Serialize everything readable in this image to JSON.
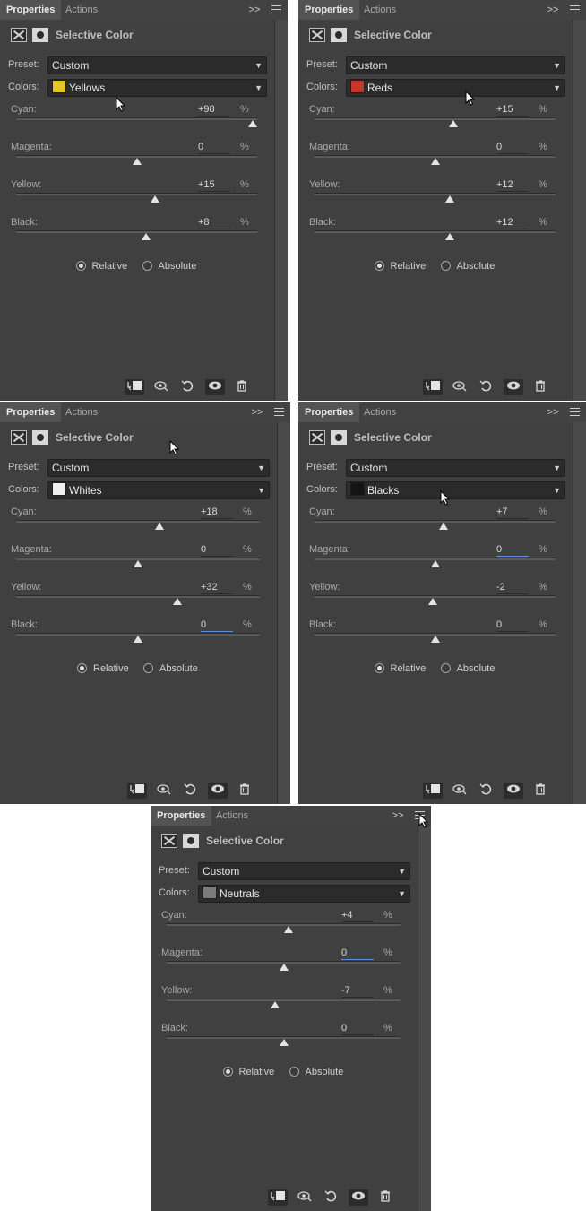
{
  "tabs": {
    "properties": "Properties",
    "actions": "Actions"
  },
  "collapse_glyph": ">>",
  "header_title": "Selective Color",
  "labels": {
    "preset": "Preset:",
    "colors": "Colors:"
  },
  "preset_value": "Custom",
  "radio": {
    "relative": "Relative",
    "absolute": "Absolute"
  },
  "percent": "%",
  "panels": [
    {
      "color_name": "Yellows",
      "swatch": "#e6c627",
      "sliders": [
        {
          "label": "Cyan:",
          "value": "+98",
          "pos": 0.98
        },
        {
          "label": "Magenta:",
          "value": "0",
          "pos": 0.5
        },
        {
          "label": "Yellow:",
          "value": "+15",
          "pos": 0.575
        },
        {
          "label": "Black:",
          "value": "+8",
          "pos": 0.54
        }
      ]
    },
    {
      "color_name": "Reds",
      "swatch": "#c0392b",
      "sliders": [
        {
          "label": "Cyan:",
          "value": "+15",
          "pos": 0.575
        },
        {
          "label": "Magenta:",
          "value": "0",
          "pos": 0.5
        },
        {
          "label": "Yellow:",
          "value": "+12",
          "pos": 0.56
        },
        {
          "label": "Black:",
          "value": "+12",
          "pos": 0.56
        }
      ]
    },
    {
      "color_name": "Whites",
      "swatch": "#efefef",
      "sliders": [
        {
          "label": "Cyan:",
          "value": "+18",
          "pos": 0.59
        },
        {
          "label": "Magenta:",
          "value": "0",
          "pos": 0.5
        },
        {
          "label": "Yellow:",
          "value": "+32",
          "pos": 0.66
        },
        {
          "label": "Black:",
          "value": "0",
          "pos": 0.5,
          "focus": true
        }
      ]
    },
    {
      "color_name": "Blacks",
      "swatch": "#141414",
      "sliders": [
        {
          "label": "Cyan:",
          "value": "+7",
          "pos": 0.535
        },
        {
          "label": "Magenta:",
          "value": "0",
          "pos": 0.5,
          "focus": true
        },
        {
          "label": "Yellow:",
          "value": "-2",
          "pos": 0.49
        },
        {
          "label": "Black:",
          "value": "0",
          "pos": 0.5
        }
      ]
    },
    {
      "color_name": "Neutrals",
      "swatch": "#7b7b7b",
      "sliders": [
        {
          "label": "Cyan:",
          "value": "+4",
          "pos": 0.52
        },
        {
          "label": "Magenta:",
          "value": "0",
          "pos": 0.5,
          "focus": true
        },
        {
          "label": "Yellow:",
          "value": "-7",
          "pos": 0.465
        },
        {
          "label": "Black:",
          "value": "0",
          "pos": 0.5
        }
      ]
    }
  ],
  "footer_icons": [
    "clip-to-layer-icon",
    "view-previous-state-icon",
    "reset-icon",
    "visibility-eye-icon",
    "trash-icon"
  ]
}
